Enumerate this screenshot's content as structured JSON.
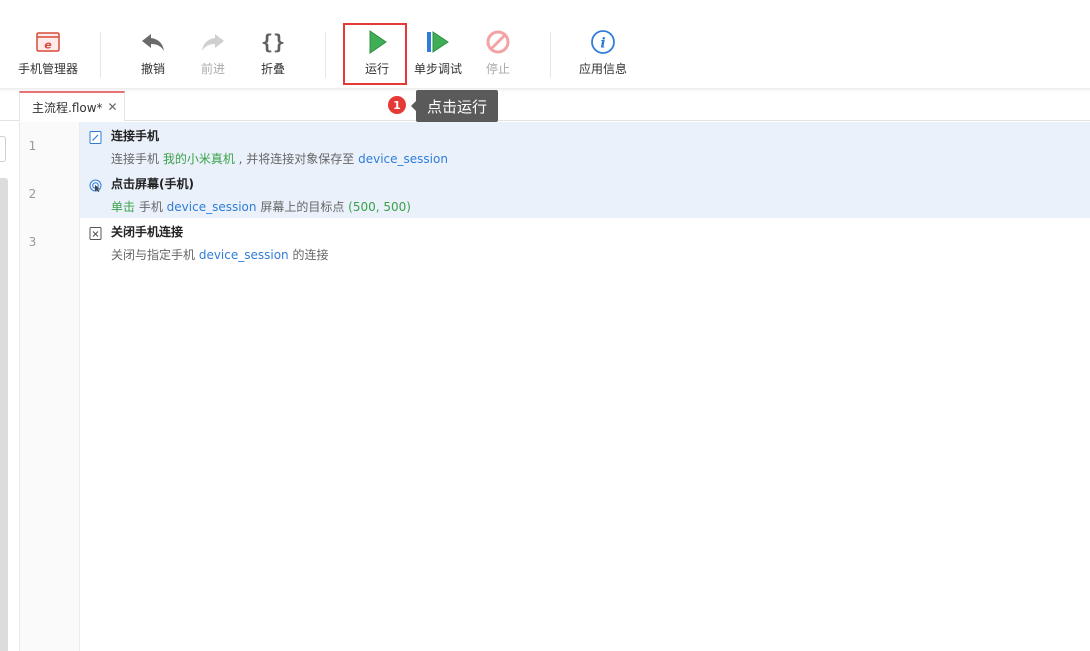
{
  "toolbar": {
    "items": [
      {
        "label": "手机管理器",
        "icon": "phone-manager-icon"
      },
      {
        "label": "撤销",
        "icon": "undo-icon"
      },
      {
        "label": "前进",
        "icon": "redo-icon",
        "disabled": true
      },
      {
        "label": "折叠",
        "icon": "fold-braces-icon"
      },
      {
        "label": "运行",
        "icon": "run-play-icon"
      },
      {
        "label": "单步调试",
        "icon": "step-debug-icon"
      },
      {
        "label": "停止",
        "icon": "stop-icon",
        "disabled": true
      },
      {
        "label": "应用信息",
        "icon": "info-icon"
      }
    ]
  },
  "tooltip": {
    "badge": "1",
    "text": "点击运行"
  },
  "tab": {
    "label": "主流程.flow*",
    "close": "✕"
  },
  "lines": [
    {
      "number": "1",
      "title": "连接手机",
      "desc": [
        {
          "text": "连接手机 ",
          "style": "plain"
        },
        {
          "text": "我的小米真机",
          "style": "green"
        },
        {
          "text": " , 并将连接对象保存至 ",
          "style": "plain"
        },
        {
          "text": "device_session",
          "style": "blue"
        }
      ]
    },
    {
      "number": "2",
      "title": "点击屏幕(手机)",
      "desc": [
        {
          "text": "单击",
          "style": "green"
        },
        {
          "text": " 手机 ",
          "style": "plain"
        },
        {
          "text": "device_session",
          "style": "blue"
        },
        {
          "text": " 屏幕上的目标点 ",
          "style": "plain"
        },
        {
          "text": "(500, 500)",
          "style": "green"
        }
      ]
    },
    {
      "number": "3",
      "title": "关闭手机连接",
      "desc": [
        {
          "text": "关闭与指定手机 ",
          "style": "plain"
        },
        {
          "text": "device_session",
          "style": "blue"
        },
        {
          "text": " 的连接",
          "style": "plain"
        }
      ]
    }
  ],
  "colors": {
    "accent_red": "#e53935",
    "green": "#3aa14a",
    "blue": "#2f7dd8",
    "highlight": "#eaf1fb"
  }
}
